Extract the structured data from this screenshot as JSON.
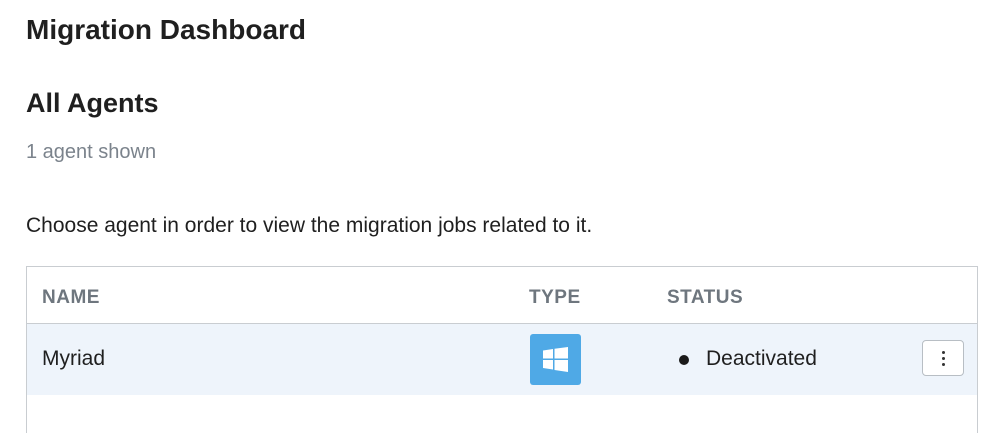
{
  "header": {
    "title": "Migration Dashboard"
  },
  "agents_section": {
    "title": "All Agents",
    "count_text": "1 agent shown",
    "instructions": "Choose agent in order to view the migration jobs related to it."
  },
  "table": {
    "columns": {
      "name": "NAME",
      "type": "TYPE",
      "status": "STATUS"
    },
    "rows": [
      {
        "name": "Myriad",
        "type_icon": "windows-icon",
        "status": "Deactivated",
        "status_color": "#1a1a1a",
        "actions_icon": "more-vertical-icon"
      }
    ]
  },
  "colors": {
    "accent_icon_bg": "#4fa9e6",
    "row_highlight": "#eef4fb",
    "muted_text": "#7b838c"
  }
}
